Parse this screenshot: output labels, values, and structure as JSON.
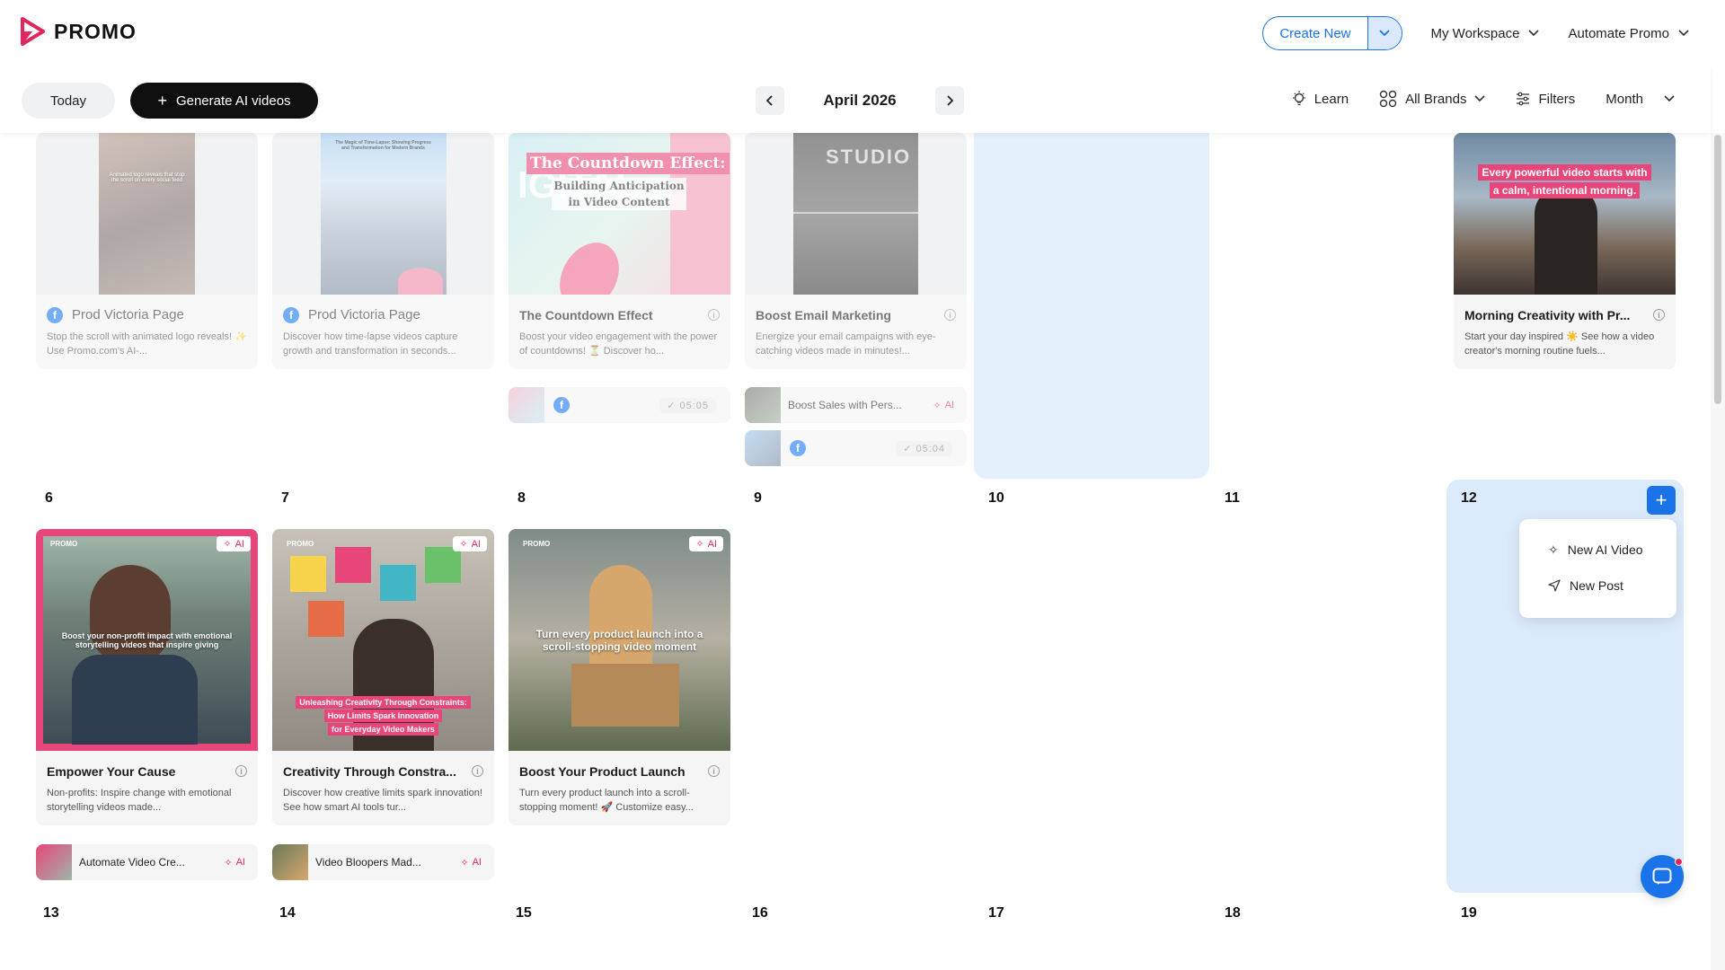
{
  "app": {
    "name": "PROMO"
  },
  "header": {
    "create_label": "Create New",
    "workspace_label": "My Workspace",
    "automate_label": "Automate Promo"
  },
  "toolbar": {
    "today_label": "Today",
    "generate_label": "Generate AI videos",
    "month_label": "April 2026",
    "learn_label": "Learn",
    "brands_label": "All Brands",
    "filters_label": "Filters",
    "view_label": "Month"
  },
  "colors": {
    "accent": "#1a73e8",
    "brand": "#e0265d",
    "highlight": "#e5f0fd"
  },
  "week1": {
    "cards": [
      {
        "page": "Prod Victoria Page",
        "desc": "Stop the scroll with animated logo reveals! ✨ Use Promo.com's AI-...",
        "thumb_text": "Animated logo reveals that stop the scroll on every social feed"
      },
      {
        "page": "Prod Victoria Page",
        "desc": "Discover how time-lapse videos capture growth and transformation in seconds...",
        "thumb_text": "The Magic of Time-Lapse: Showing Progress and Transformation for Modern Brands"
      },
      {
        "title": "The Countdown Effect",
        "desc": "Boost your video engagement with the power of countdowns! ⏳ Discover ho...",
        "thumb_title": "The Countdown Effect:",
        "thumb_sub1": "Building Anticipation",
        "thumb_sub2": "in Video Content",
        "bg_word": "IGITAL"
      },
      {
        "title": "Boost Email Marketing",
        "desc": "Energize your email campaigns with eye-catching videos made in minutes!...",
        "thumb_text": "STUDIO"
      },
      {
        "title": "Morning Creativity with Pr...",
        "desc": "Start your day inspired ☀️ See how a video creator's morning routine fuels...",
        "thumb_line1": "Every powerful video starts with",
        "thumb_line2": "a calm, intentional morning."
      }
    ],
    "minis": [
      {
        "time": "05:05"
      },
      {
        "text": "Boost Sales with Pers...",
        "ai": "AI"
      },
      {
        "time": "05:04"
      }
    ]
  },
  "week2": {
    "days": [
      "6",
      "7",
      "8",
      "9",
      "10",
      "11",
      "12"
    ],
    "cards": [
      {
        "title": "Empower Your Cause",
        "desc": "Non-profits: Inspire change with emotional storytelling videos made...",
        "caption": "Boost your non-profit impact with emotional storytelling videos that inspire giving",
        "ai": "AI",
        "brand": "PROMO"
      },
      {
        "title": "Creativity Through Constra...",
        "desc": "Discover how creative limits spark innovation! See how smart AI tools tur...",
        "caption1": "Unleashing Creativity Through Constraints:",
        "caption2": "How Limits Spark Innovation",
        "caption3": "for Everyday Video Makers",
        "ai": "AI",
        "brand": "PROMO"
      },
      {
        "title": "Boost Your Product Launch",
        "desc": "Turn every product launch into a scroll-stopping moment! 🚀 Customize easy...",
        "caption": "Turn every product launch into a scroll-stopping video moment",
        "ai": "AI",
        "brand": "PROMO"
      }
    ],
    "minis": [
      {
        "text": "Automate Video Cre...",
        "ai": "AI"
      },
      {
        "text": "Video Bloopers Mad...",
        "ai": "AI"
      }
    ],
    "popover": {
      "new_ai_video": "New AI Video",
      "new_post": "New Post"
    }
  },
  "week3": {
    "days": [
      "13",
      "14",
      "15",
      "16",
      "17",
      "18",
      "19"
    ]
  }
}
